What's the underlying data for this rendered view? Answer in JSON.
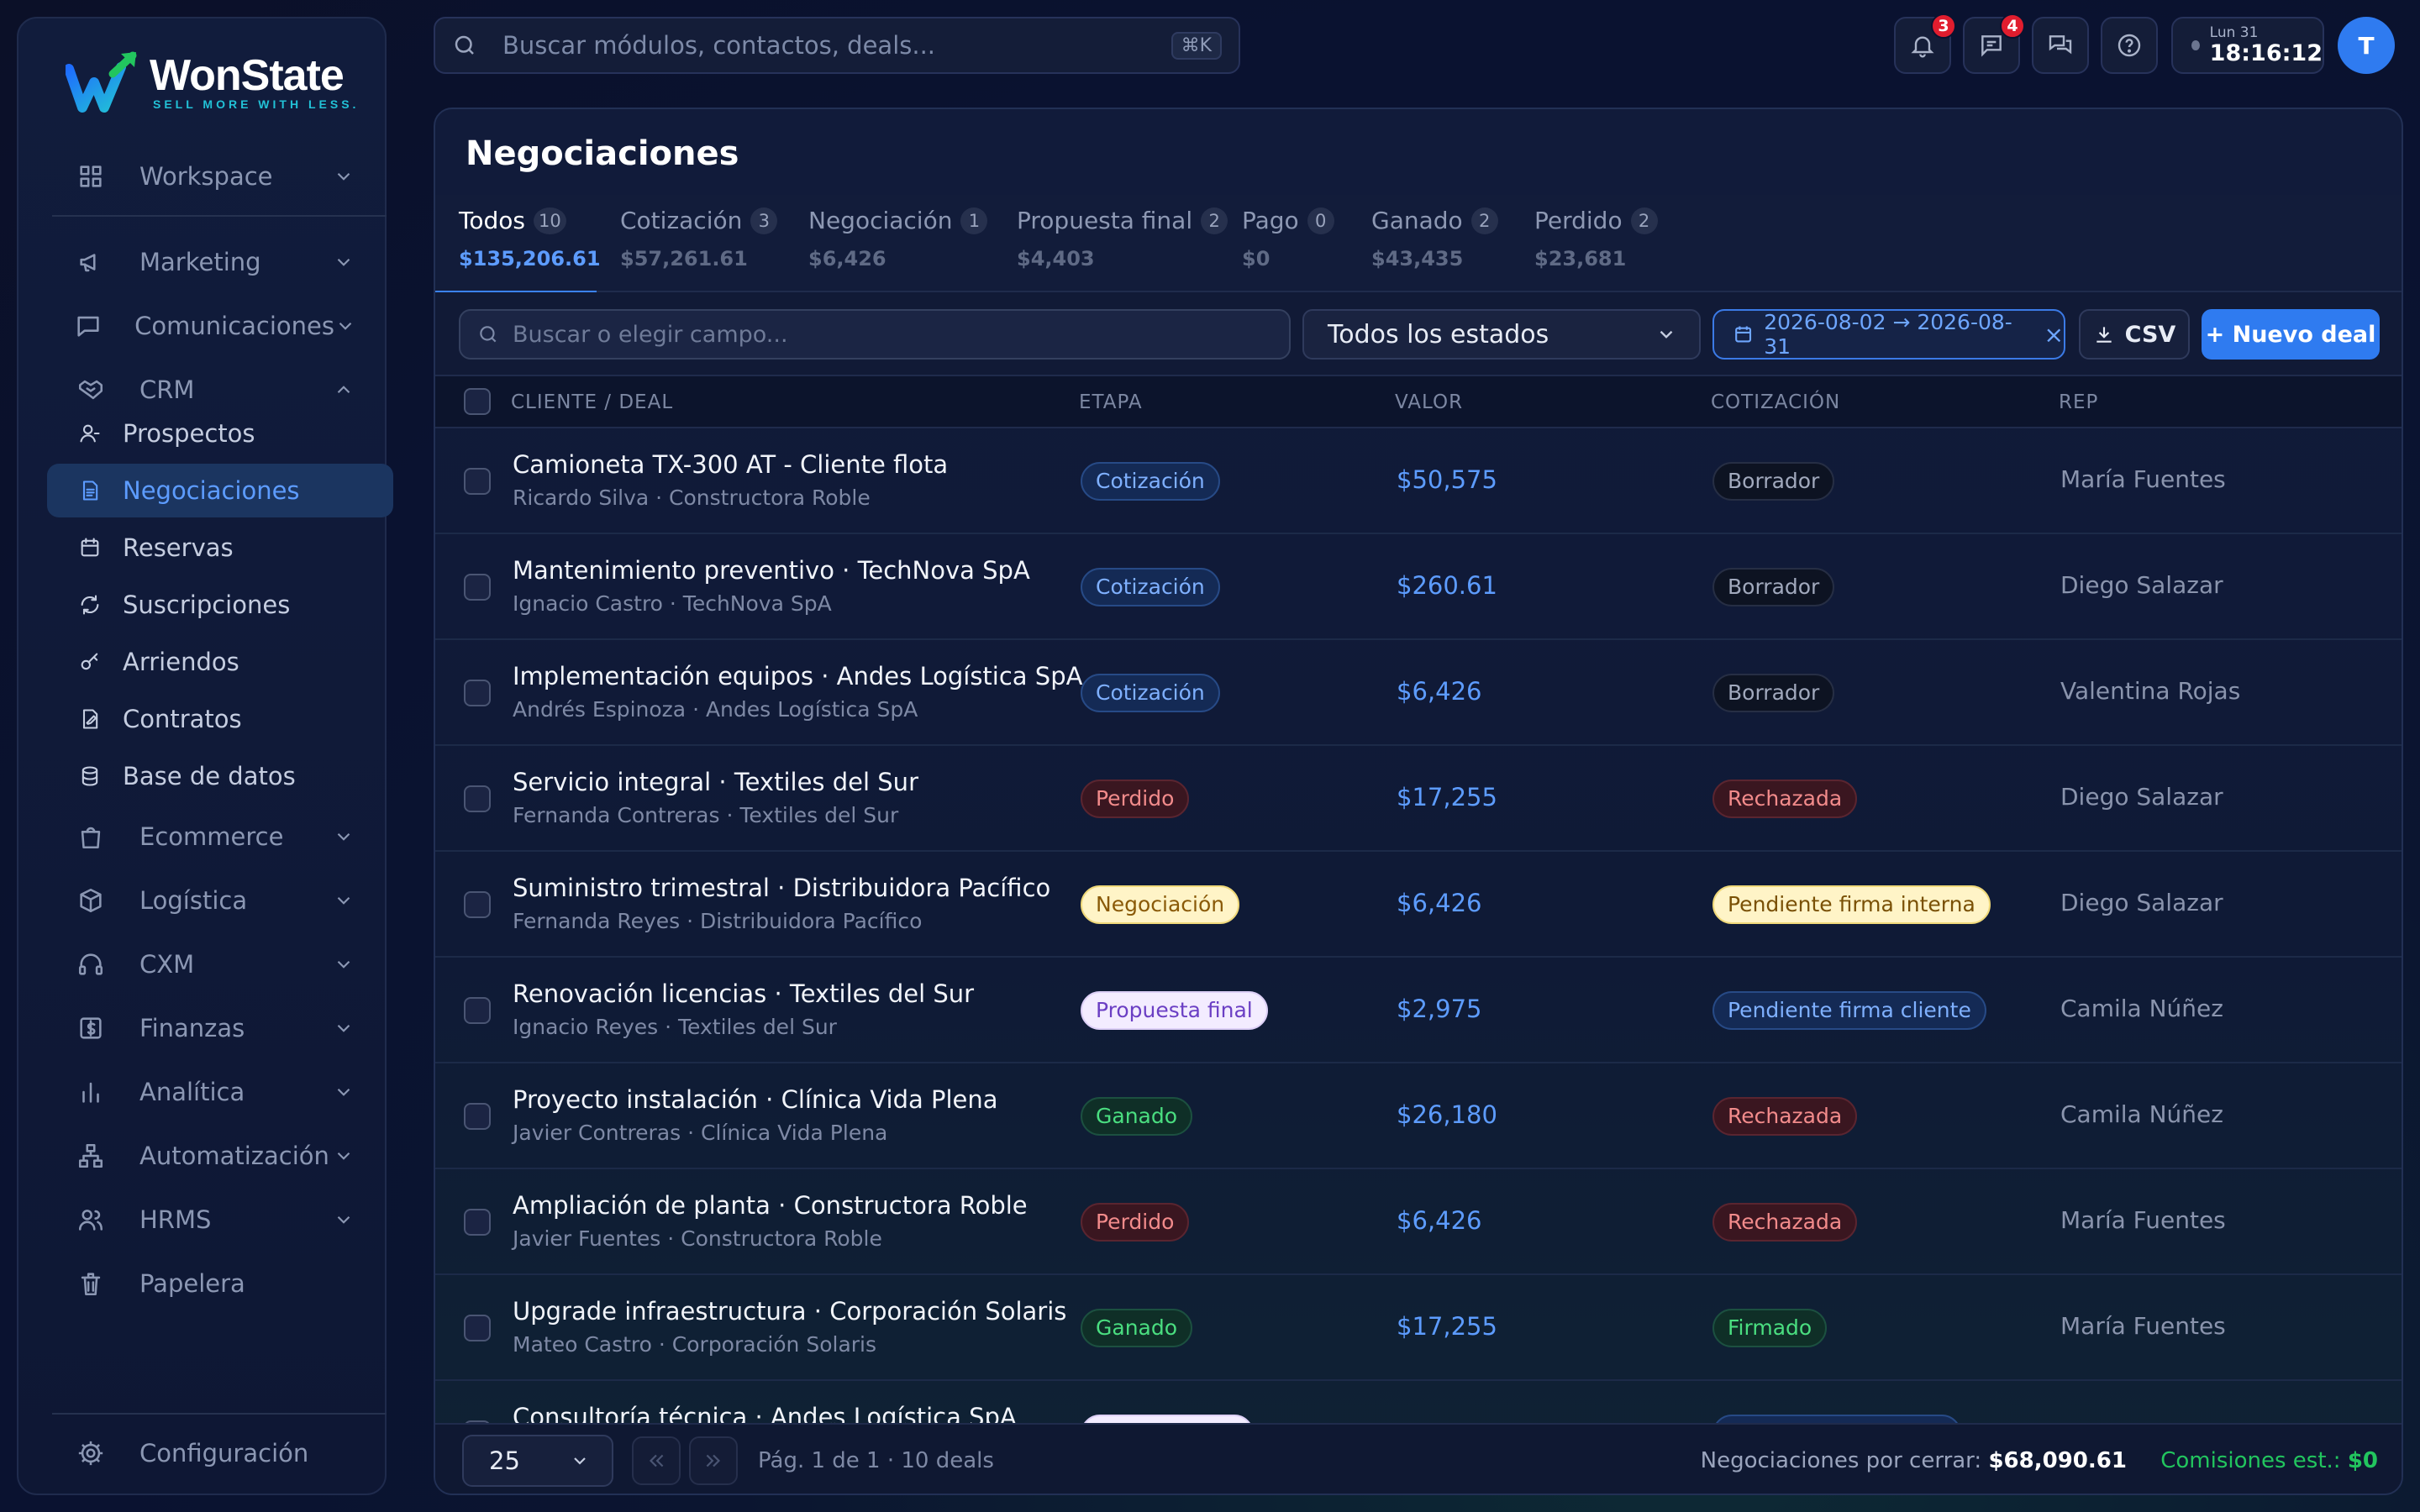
{
  "brand": {
    "name": "WonState",
    "tagline": "SELL MORE WITH LESS."
  },
  "sidebar": {
    "groups_top": [
      {
        "label": "Workspace",
        "icon": "grid-icon"
      }
    ],
    "groups_mid": [
      {
        "label": "Marketing",
        "icon": "megaphone-icon"
      },
      {
        "label": "Comunicaciones",
        "icon": "chat-icon"
      },
      {
        "label": "CRM",
        "icon": "handshake-icon",
        "expanded": true
      }
    ],
    "crm_items": [
      {
        "label": "Prospectos",
        "icon": "user-icon"
      },
      {
        "label": "Negociaciones",
        "icon": "document-icon",
        "active": true
      },
      {
        "label": "Reservas",
        "icon": "calendar-icon"
      },
      {
        "label": "Suscripciones",
        "icon": "refresh-icon"
      },
      {
        "label": "Arriendos",
        "icon": "key-icon"
      },
      {
        "label": "Contratos",
        "icon": "contract-icon"
      },
      {
        "label": "Base de datos",
        "icon": "database-icon"
      }
    ],
    "groups_bottom": [
      {
        "label": "Ecommerce",
        "icon": "shopping-bag-icon"
      },
      {
        "label": "Logística",
        "icon": "box-icon"
      },
      {
        "label": "CXM",
        "icon": "headset-icon"
      },
      {
        "label": "Finanzas",
        "icon": "dollar-icon"
      },
      {
        "label": "Analítica",
        "icon": "bar-chart-icon"
      },
      {
        "label": "Automatización",
        "icon": "flow-icon"
      },
      {
        "label": "HRMS",
        "icon": "users-icon"
      },
      {
        "label": "Papelera",
        "icon": "trash-icon"
      }
    ],
    "settings_label": "Configuración"
  },
  "topbar": {
    "search_placeholder": "Buscar módulos, contactos, deals...",
    "search_shortcut": "⌘K",
    "notifications_count": "3",
    "messages_count": "4",
    "clock_day": "Lun 31",
    "clock_time": "18:16:12",
    "avatar_initial": "T"
  },
  "page": {
    "title": "Negociaciones",
    "tabs": [
      {
        "name": "Todos",
        "count": "10",
        "value": "$135,206.61",
        "active": true
      },
      {
        "name": "Cotización",
        "count": "3",
        "value": "$57,261.61"
      },
      {
        "name": "Negociación",
        "count": "1",
        "value": "$6,426"
      },
      {
        "name": "Propuesta final",
        "count": "2",
        "value": "$4,403"
      },
      {
        "name": "Pago",
        "count": "0",
        "value": "$0"
      },
      {
        "name": "Ganado",
        "count": "2",
        "value": "$43,435"
      },
      {
        "name": "Perdido",
        "count": "2",
        "value": "$23,681"
      }
    ],
    "filters": {
      "search_placeholder": "Buscar o elegir campo...",
      "status_select": "Todos los estados",
      "date_range": "2026-08-02 → 2026-08-31",
      "csv_label": "CSV",
      "new_deal_label": "+ Nuevo deal"
    },
    "columns": [
      "CLIENTE / DEAL",
      "ETAPA",
      "VALOR",
      "COTIZACIÓN",
      "REP"
    ],
    "rows": [
      {
        "title": "Camioneta TX-300 AT - Cliente flota",
        "sub": "Ricardo Silva · Constructora Roble",
        "stage": "Cotización",
        "stage_kind": "cot",
        "value": "$50,575",
        "quote": "Borrador",
        "quote_kind": "borr",
        "rep": "María Fuentes"
      },
      {
        "title": "Mantenimiento preventivo · TechNova SpA",
        "sub": "Ignacio Castro · TechNova SpA",
        "stage": "Cotización",
        "stage_kind": "cot",
        "value": "$260.61",
        "quote": "Borrador",
        "quote_kind": "borr",
        "rep": "Diego Salazar"
      },
      {
        "title": "Implementación equipos · Andes Logística SpA",
        "sub": "Andrés Espinoza · Andes Logística SpA",
        "stage": "Cotización",
        "stage_kind": "cot",
        "value": "$6,426",
        "quote": "Borrador",
        "quote_kind": "borr",
        "rep": "Valentina Rojas"
      },
      {
        "title": "Servicio integral · Textiles del Sur",
        "sub": "Fernanda Contreras · Textiles del Sur",
        "stage": "Perdido",
        "stage_kind": "perd",
        "value": "$17,255",
        "quote": "Rechazada",
        "quote_kind": "rech",
        "rep": "Diego Salazar"
      },
      {
        "title": "Suministro trimestral · Distribuidora Pacífico",
        "sub": "Fernanda Reyes · Distribuidora Pacífico",
        "stage": "Negociación",
        "stage_kind": "neg",
        "value": "$6,426",
        "quote": "Pendiente firma interna",
        "quote_kind": "pfi",
        "rep": "Diego Salazar"
      },
      {
        "title": "Renovación licencias · Textiles del Sur",
        "sub": "Ignacio Reyes · Textiles del Sur",
        "stage": "Propuesta final",
        "stage_kind": "prop",
        "value": "$2,975",
        "quote": "Pendiente firma cliente",
        "quote_kind": "pfc",
        "rep": "Camila Núñez"
      },
      {
        "title": "Proyecto instalación · Clínica Vida Plena",
        "sub": "Javier Contreras · Clínica Vida Plena",
        "stage": "Ganado",
        "stage_kind": "gan",
        "value": "$26,180",
        "quote": "Rechazada",
        "quote_kind": "rech",
        "rep": "Camila Núñez"
      },
      {
        "title": "Ampliación de planta · Constructora Roble",
        "sub": "Javier Fuentes · Constructora Roble",
        "stage": "Perdido",
        "stage_kind": "perd",
        "value": "$6,426",
        "quote": "Rechazada",
        "quote_kind": "rech",
        "rep": "María Fuentes"
      },
      {
        "title": "Upgrade infraestructura · Corporación Solaris",
        "sub": "Mateo Castro · Corporación Solaris",
        "stage": "Ganado",
        "stage_kind": "gan",
        "value": "$17,255",
        "quote": "Firmado",
        "quote_kind": "firm",
        "rep": "María Fuentes"
      },
      {
        "title": "Consultoría técnica · Andes Logística SpA",
        "sub": "",
        "stage": "",
        "stage_kind": "prop",
        "value": "",
        "quote": "",
        "quote_kind": "pfc",
        "rep": ""
      }
    ],
    "footer": {
      "page_size": "25",
      "page_info": "Pág. 1 de 1 · 10 deals",
      "closing_label": "Negociaciones por cerrar:",
      "closing_value": "$68,090.61",
      "commission_label": "Comisiones est.:",
      "commission_value": "$0"
    }
  }
}
